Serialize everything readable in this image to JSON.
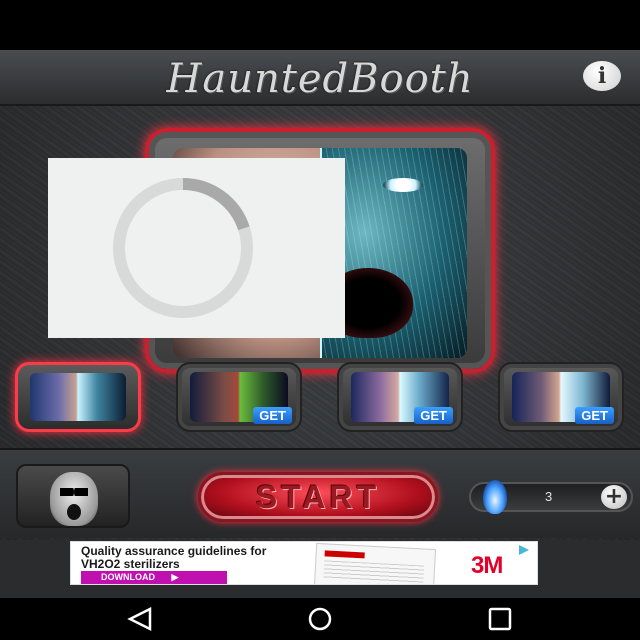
{
  "header": {
    "app_title": "HauntedBooth",
    "info_icon": "info-icon",
    "info_label": "i"
  },
  "main_preview": {
    "description_icon": "face-split-image"
  },
  "loading": {
    "spinner_icon": "loading-spinner-icon",
    "progress": 0.2
  },
  "effects": {
    "items": [
      {
        "name": "effect-1",
        "selected": true,
        "badge": ""
      },
      {
        "name": "effect-2",
        "selected": false,
        "badge": "GET"
      },
      {
        "name": "effect-3",
        "selected": false,
        "badge": "GET"
      },
      {
        "name": "effect-4",
        "selected": false,
        "badge": "GET"
      }
    ]
  },
  "controls": {
    "start_label": "START",
    "credit_count": "3",
    "add_label": "+",
    "flame_icon": "blue-flame-icon"
  },
  "ad": {
    "headline": "Quality assurance guidelines for VH2O2 sterilizers",
    "cta": "DOWNLOAD",
    "cta_icon": "play-arrow-icon",
    "logo": "3M",
    "choices_icon": "ad-choices-icon"
  },
  "navigation": {
    "back_icon": "back-triangle-icon",
    "home_icon": "home-circle-icon",
    "recents_icon": "recents-square-icon"
  },
  "colors": {
    "accent_red": "#cc1f2e",
    "get_blue": "#1760c8",
    "ad_cta": "#c010b0",
    "logo_red": "#e4002b"
  }
}
